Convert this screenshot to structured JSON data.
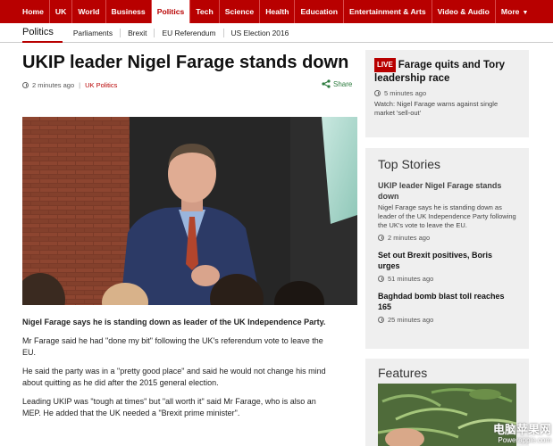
{
  "topnav": {
    "items": [
      "Home",
      "UK",
      "World",
      "Business",
      "Politics",
      "Tech",
      "Science",
      "Health",
      "Education",
      "Entertainment & Arts",
      "Video & Audio",
      "More"
    ],
    "active_index": 4
  },
  "subnav": {
    "section": "Politics",
    "links": [
      "Parliaments",
      "Brexit",
      "EU Referendum",
      "US Election 2016"
    ]
  },
  "article": {
    "headline": "UKIP leader Nigel Farage stands down",
    "time": "2 minutes ago",
    "topic": "UK Politics",
    "share": "Share",
    "paragraphs": [
      "Nigel Farage says he is standing down as leader of the UK Independence Party.",
      "Mr Farage said he had \"done my bit\" following the UK's referendum vote to leave the EU.",
      "He said the party was in a \"pretty good place\" and said he would not change his mind about quitting as he did after the 2015 general election.",
      "Leading UKIP was \"tough at times\" but \"all worth it\" said Mr Farage, who is also an MEP. He added that the UK needed a \"Brexit prime minister\"."
    ]
  },
  "live": {
    "badge": "LIVE",
    "title": "Farage quits and Tory leadership race",
    "time": "5 minutes ago",
    "watch": "Watch: Nigel Farage warns against single market 'sell-out'"
  },
  "top_stories": {
    "heading": "Top Stories",
    "items": [
      {
        "title": "UKIP leader Nigel Farage stands down",
        "summary": "Nigel Farage says he is standing down as leader of the UK Independence Party following the UK's vote to leave the EU.",
        "time": "2 minutes ago"
      },
      {
        "title": "Set out Brexit positives, Boris urges",
        "time": "51 minutes ago"
      },
      {
        "title": "Baghdad bomb blast toll reaches 165",
        "time": "25 minutes ago"
      }
    ]
  },
  "features": {
    "heading": "Features"
  },
  "watermark": {
    "main": "电脑苹果网",
    "sub": "Powerapple.com"
  },
  "colors": {
    "brand_red": "#b80000",
    "share_green": "#2b7a3d",
    "panel_grey": "#efefef"
  }
}
